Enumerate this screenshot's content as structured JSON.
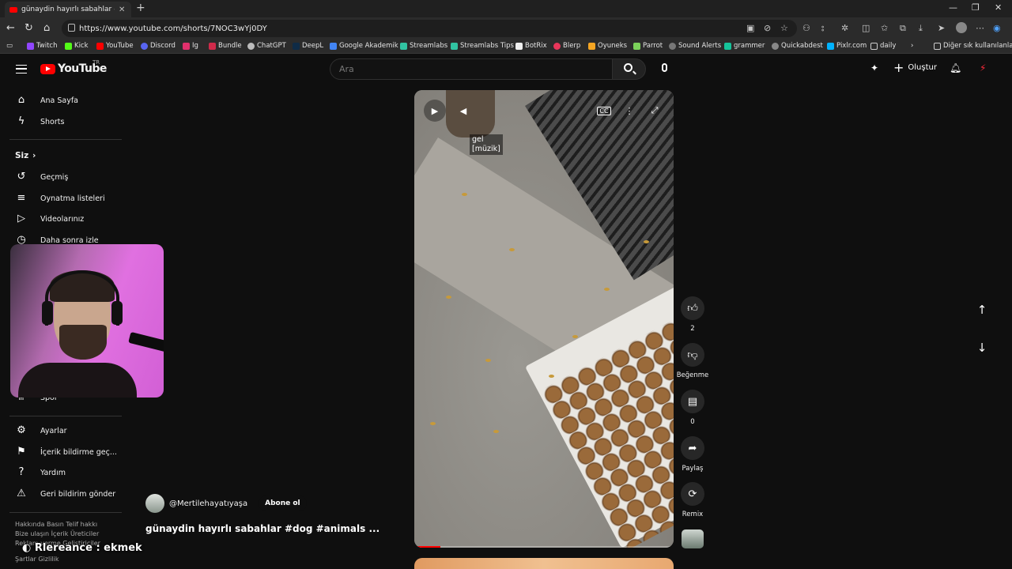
{
  "browser": {
    "tab_title": "günaydin hayırlı sabahlar #dog #...",
    "url": "https://www.youtube.com/shorts/7NOC3wYj0DY",
    "bookmarks": [
      "Twitch",
      "Kick",
      "YouTube",
      "Discord",
      "Ig",
      "Bundle",
      "ChatGPT",
      "DeepL",
      "Google Akademik",
      "Streamlabs",
      "Streamlabs Tips",
      "BotRix",
      "Blerp",
      "Oyuneks",
      "Parrot",
      "Sound Alerts",
      "grammer",
      "Quickabdest",
      "Pixlr.com",
      "daily"
    ],
    "other_bookmarks": "Diğer sık kullanılanlar"
  },
  "header": {
    "logo": "YouTube",
    "region": "TR",
    "search_placeholder": "Ara",
    "create_label": "Oluştur"
  },
  "sidebar": {
    "home": "Ana Sayfa",
    "shorts": "Shorts",
    "you_header": "Siz",
    "history": "Geçmiş",
    "playlists": "Oynatma listeleri",
    "your_videos": "Videolarınız",
    "watch_later": "Daha sonra izle",
    "sports": "Spor",
    "settings": "Ayarlar",
    "report_history": "İçerik bildirme geç...",
    "help": "Yardım",
    "send_feedback": "Geri bildirim gönder",
    "footer_line1": "Hakkında  Basın  Telif hakkı",
    "footer_line2": "Bize ulaşın  İçerik Üreticiler",
    "footer_line3": "Reklam verme  Geliştiriciler",
    "footer_line4": "Şartlar  Gizlilik"
  },
  "player": {
    "caption_line1": "gel",
    "caption_line2": "[müzik]",
    "cc_label": "CC",
    "progress": 0.1
  },
  "actions": {
    "like_count": "2",
    "dislike_label": "Beğenme",
    "comment_count": "0",
    "share_label": "Paylaş",
    "remix_label": "Remix"
  },
  "video": {
    "channel": "@Mertilehayatıyaşa",
    "subscribe": "Abone ol",
    "title": "günaydin hayırlı sabahlar #dog #animals ..."
  },
  "overlay": {
    "stream_text": "Rlereance : ekmek"
  }
}
